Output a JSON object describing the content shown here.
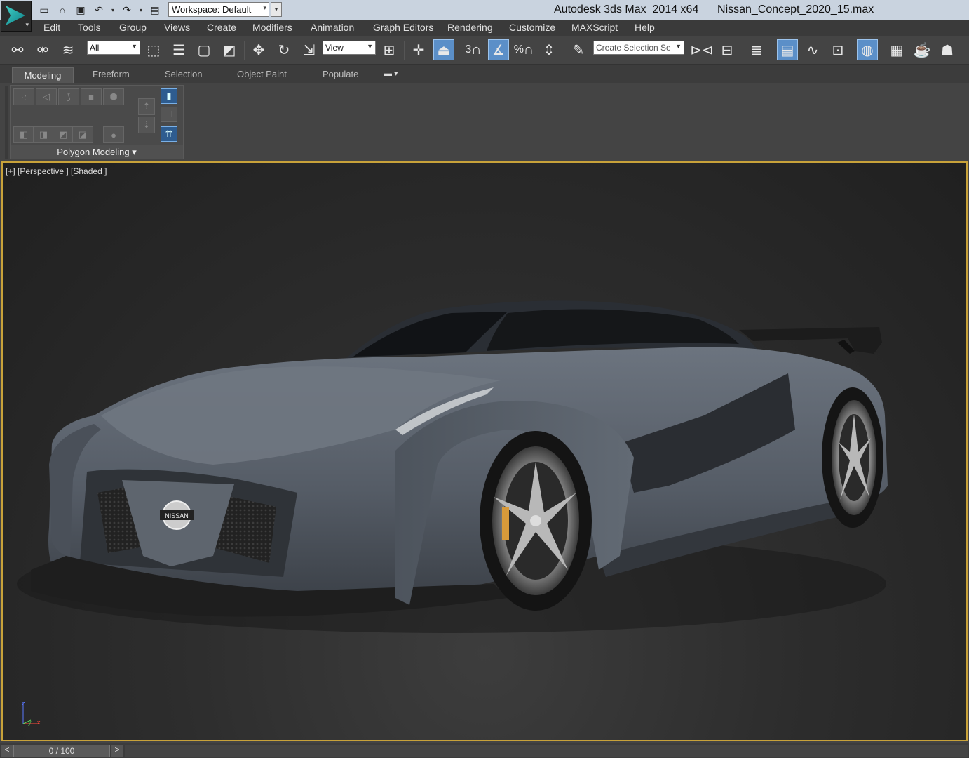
{
  "window": {
    "title": "Autodesk 3ds Max  2014 x64      Nissan_Concept_2020_15.max"
  },
  "quick_access": {
    "icons": [
      "new-icon",
      "open-icon",
      "save-icon",
      "undo-icon",
      "redo-icon",
      "project-folder-icon"
    ],
    "workspace_value": "Workspace: Default"
  },
  "menu": {
    "items": [
      "Edit",
      "Tools",
      "Group",
      "Views",
      "Create",
      "Modifiers",
      "Animation",
      "Graph Editors",
      "Rendering",
      "Customize",
      "MAXScript",
      "Help"
    ]
  },
  "toolbar": {
    "selection_filter": "All",
    "ref_coord": "View",
    "snap_label": "3",
    "percent_label": "%",
    "named_selection_placeholder": "Create Selection Se"
  },
  "ribbon": {
    "tabs": [
      "Modeling",
      "Freeform",
      "Selection",
      "Object Paint",
      "Populate"
    ],
    "active_tab": "Modeling",
    "group_label": "Polygon Modeling"
  },
  "viewport": {
    "label": "[+] [Perspective ] [Shaded ]",
    "logo_text": "NISSAN",
    "border_color": "#c8a23a",
    "axes": {
      "x": "x",
      "y": "y",
      "z": "z"
    }
  },
  "timeline": {
    "frame": "0 / 100",
    "prev": "<",
    "next": ">"
  },
  "colors": {
    "titlebar": "#c9d3df",
    "active_button": "#5b8fc8",
    "car_body": "#5d6570"
  }
}
